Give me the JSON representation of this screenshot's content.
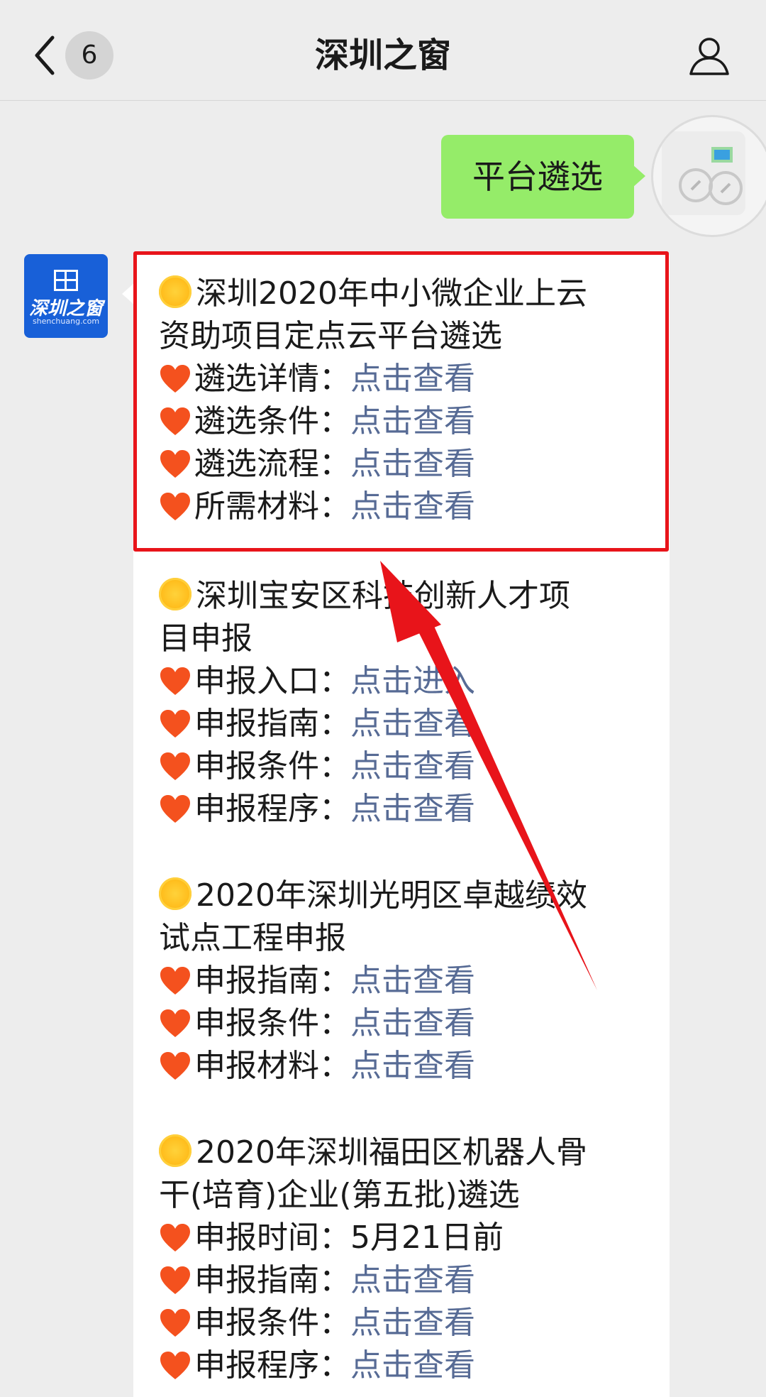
{
  "header": {
    "title": "深圳之窗",
    "back_badge": "6",
    "back_icon": "chevron-left-icon",
    "profile_icon": "user-icon"
  },
  "outgoing_message": {
    "text": "平台遴选"
  },
  "incoming_sender": {
    "avatar_text": "深圳之窗",
    "avatar_subtext": "shenchuang.com"
  },
  "message_sections": [
    {
      "title": "深圳2020年中小微企业上云资助项目定点云平台遴选",
      "title_lines": [
        "深圳2020年中小微企业上云",
        "资助项目定点云平台遴选"
      ],
      "rows": [
        {
          "label": "遴选详情：",
          "value": "点击查看"
        },
        {
          "label": "遴选条件：",
          "value": "点击查看"
        },
        {
          "label": "遴选流程：",
          "value": "点击查看"
        },
        {
          "label": "所需材料：",
          "value": "点击查看"
        }
      ]
    },
    {
      "title_lines": [
        "深圳宝安区科技创新人才项",
        "目申报"
      ],
      "rows": [
        {
          "label": "申报入口：",
          "value": "点击进入"
        },
        {
          "label": "申报指南：",
          "value": "点击查看"
        },
        {
          "label": "申报条件：",
          "value": "点击查看"
        },
        {
          "label": "申报程序：",
          "value": "点击查看"
        }
      ]
    },
    {
      "title_lines": [
        "2020年深圳光明区卓越绩效",
        "试点工程申报"
      ],
      "rows": [
        {
          "label": "申报指南：",
          "value": "点击查看"
        },
        {
          "label": "申报条件：",
          "value": "点击查看"
        },
        {
          "label": "申报材料：",
          "value": "点击查看"
        }
      ]
    },
    {
      "title_lines": [
        "2020年深圳福田区机器人骨",
        "干(培育)企业(第五批)遴选"
      ],
      "rows": [
        {
          "label": "申报时间：",
          "value": "5月21日前"
        },
        {
          "label": "申报指南：",
          "value": "点击查看"
        },
        {
          "label": "申报条件：",
          "value": "点击查看"
        },
        {
          "label": "申报程序：",
          "value": "点击查看"
        }
      ]
    }
  ],
  "colors": {
    "link": "#576b95",
    "outgoing_bubble": "#95ec69",
    "highlight": "#e8141a",
    "avatar_blue": "#1860d8"
  }
}
